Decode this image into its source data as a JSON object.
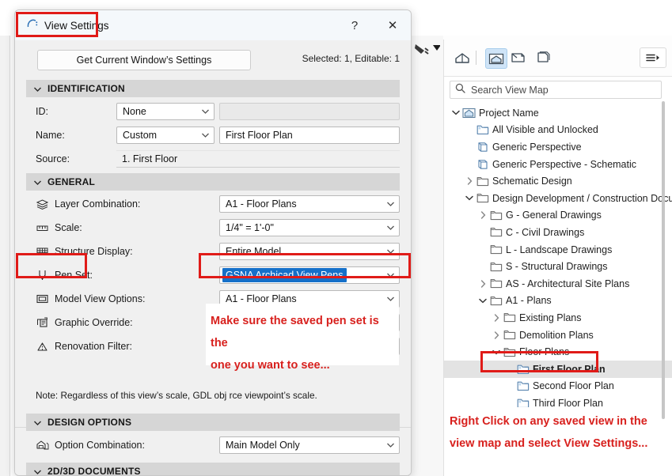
{
  "background": {
    "ghost_icon": "pen-tool-icon"
  },
  "dialog": {
    "title": "View Settings",
    "title_icon": "archicad-view-icon",
    "help_label": "?",
    "close_label": "✕",
    "get_settings_label": "Get Current Window’s Settings",
    "selected_status": "Selected: 1, Editable: 1",
    "sections": {
      "identification": {
        "title": "IDENTIFICATION",
        "rows": [
          {
            "label": "ID:",
            "combo_value": "None",
            "field_value": ""
          },
          {
            "label": "Name:",
            "combo_value": "Custom",
            "field_value": "First Floor Plan"
          },
          {
            "label": "Source:",
            "field_value": "1. First Floor"
          }
        ]
      },
      "general": {
        "title": "GENERAL",
        "rows": [
          {
            "label": "Layer Combination:",
            "icon": "layers-icon",
            "value": "A1 - Floor Plans"
          },
          {
            "label": "Scale:",
            "icon": "ruler-icon",
            "value": "1/4\"  =   1'-0\""
          },
          {
            "label": "Structure Display:",
            "icon": "structure-icon",
            "value": "Entire Model"
          },
          {
            "label": "Pen Set:",
            "icon": "pen-icon",
            "value": "GSNA Archicad View Pens"
          },
          {
            "label": "Model View Options:",
            "icon": "monitor-icon",
            "value": "A1 - Floor Plans"
          },
          {
            "label": "Graphic Override:",
            "icon": "graphic-override-icon",
            "value": ""
          },
          {
            "label": "Renovation Filter:",
            "icon": "renovation-icon",
            "value": ""
          }
        ],
        "note": "Note: Regardless of this view’s scale, GDL obj                                                          rce viewpoint’s scale."
      },
      "design_options": {
        "title": "DESIGN OPTIONS",
        "rows": [
          {
            "label": "Option Combination:",
            "icon": "design-options-icon",
            "value": "Main Model Only"
          }
        ]
      },
      "documents_2d3d": {
        "title": "2D/3D DOCUMENTS"
      }
    }
  },
  "view_map": {
    "toolbar": {
      "icons": [
        "project-map-icon",
        "view-map-icon",
        "layout-book-icon",
        "publisher-sets-icon"
      ],
      "active_index": 1,
      "menu_icon": "hamburger-menu-icon"
    },
    "search": {
      "placeholder": "Search View Map",
      "icon": "search-icon"
    },
    "tree": [
      {
        "label": "Project Name",
        "depth": 0,
        "arrow": "down",
        "icon": "project-home-icon",
        "bold": false
      },
      {
        "label": "All Visible and Unlocked",
        "depth": 1,
        "arrow": "none",
        "icon": "view-icon",
        "bold": false
      },
      {
        "label": "Generic Perspective",
        "depth": 1,
        "arrow": "none",
        "icon": "perspective-icon",
        "bold": false
      },
      {
        "label": "Generic Perspective - Schematic",
        "depth": 1,
        "arrow": "none",
        "icon": "perspective-icon",
        "bold": false
      },
      {
        "label": "Schematic Design",
        "depth": 1,
        "arrow": "right",
        "icon": "folder-icon",
        "bold": false
      },
      {
        "label": "Design Development / Construction Docun",
        "depth": 1,
        "arrow": "down",
        "icon": "folder-icon",
        "bold": false
      },
      {
        "label": "G - General Drawings",
        "depth": 2,
        "arrow": "right",
        "icon": "folder-icon",
        "bold": false
      },
      {
        "label": "C - Civil Drawings",
        "depth": 2,
        "arrow": "none",
        "icon": "folder-icon",
        "bold": false
      },
      {
        "label": "L - Landscape Drawings",
        "depth": 2,
        "arrow": "none",
        "icon": "folder-icon",
        "bold": false
      },
      {
        "label": "S - Structural Drawings",
        "depth": 2,
        "arrow": "none",
        "icon": "folder-icon",
        "bold": false
      },
      {
        "label": "AS - Architectural Site Plans",
        "depth": 2,
        "arrow": "right",
        "icon": "folder-icon",
        "bold": false
      },
      {
        "label": "A1 - Plans",
        "depth": 2,
        "arrow": "down",
        "icon": "folder-icon",
        "bold": false
      },
      {
        "label": "Existing Plans",
        "depth": 3,
        "arrow": "right",
        "icon": "folder-icon",
        "bold": false
      },
      {
        "label": "Demolition Plans",
        "depth": 3,
        "arrow": "right",
        "icon": "folder-icon",
        "bold": false
      },
      {
        "label": "Floor Plans",
        "depth": 3,
        "arrow": "down",
        "icon": "folder-icon",
        "bold": false
      },
      {
        "label": "First Floor Plan",
        "depth": 4,
        "arrow": "none",
        "icon": "view-icon",
        "bold": true,
        "selected": true
      },
      {
        "label": "Second Floor Plan",
        "depth": 4,
        "arrow": "none",
        "icon": "view-icon",
        "bold": false
      },
      {
        "label": "Third Floor Plan",
        "depth": 4,
        "arrow": "none",
        "icon": "view-icon",
        "bold": false
      }
    ]
  },
  "annotations": {
    "accent_color": "#d8211e",
    "title_box": "View Settings",
    "penset_label_box": "Pen Set:",
    "penset_value_box": "GSNA Archicad View Pens",
    "first_floor_plan_box": "First Floor Plan",
    "note_dialog": "Make sure the saved pen set is the one you want to see...",
    "note_dialog_line1": "Make sure the saved pen set is the",
    "note_dialog_line2": "one you want to see...",
    "note_viewmap_line1": "Right Click on any saved view in the",
    "note_viewmap_line2": "view map and select View Settings..."
  }
}
